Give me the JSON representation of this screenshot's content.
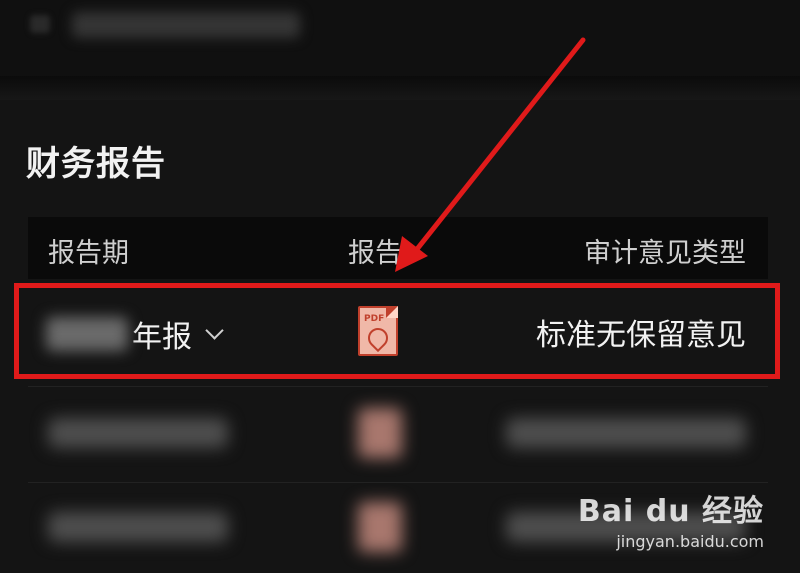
{
  "section": {
    "title": "财务报告"
  },
  "table": {
    "headers": {
      "period": "报告期",
      "report": "报告",
      "audit": "审计意见类型"
    },
    "rows": [
      {
        "period_suffix": "年报",
        "report_icon": "pdf-icon",
        "audit_opinion": "标准无保留意见"
      }
    ]
  },
  "annotation": {
    "color": "#e01a1a"
  },
  "watermark": {
    "logo": "Bai du 经验",
    "url": "jingyan.baidu.com"
  }
}
